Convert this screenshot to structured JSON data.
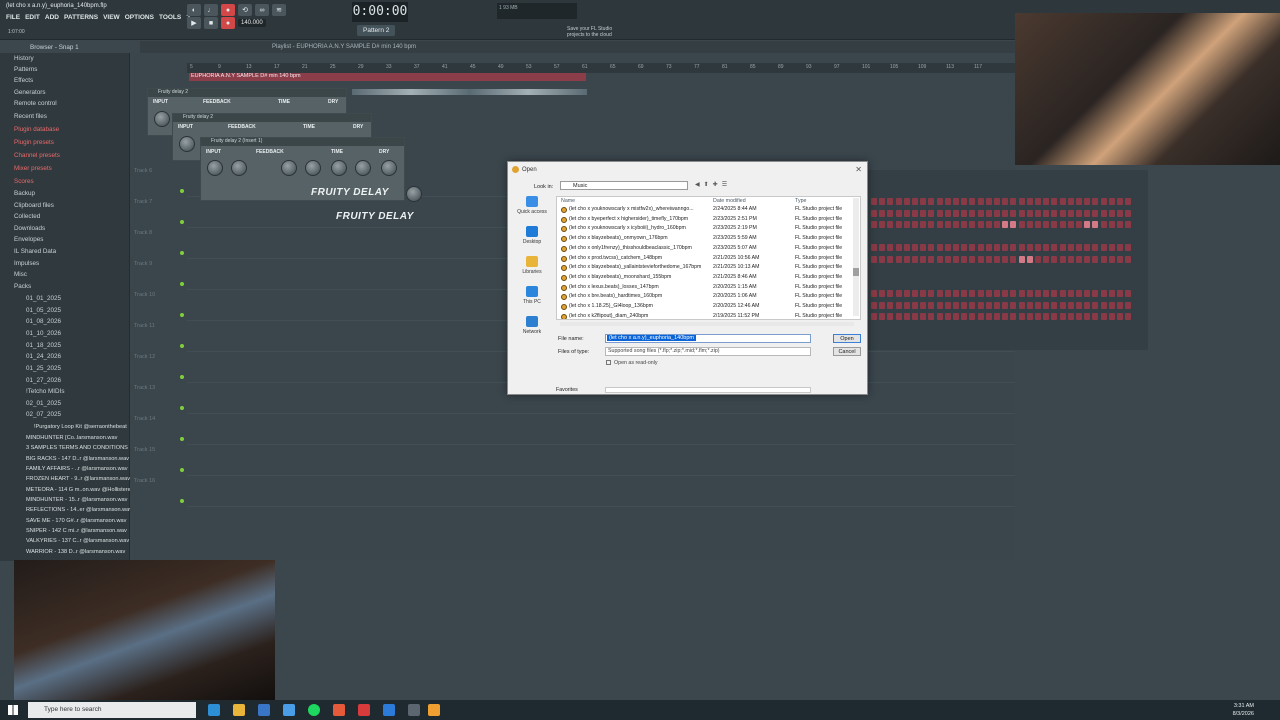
{
  "window_title": "(let cho x a.n.y)_euphoria_140bpm.flp",
  "menu": [
    "FILE",
    "EDIT",
    "ADD",
    "PATTERNS",
    "VIEW",
    "OPTIONS",
    "TOOLS",
    "?"
  ],
  "small_time": "1:07:00",
  "clock": "0:00:00",
  "tempo": "140.000",
  "pattern": "Pattern 2",
  "cloud_hint": "Save your FL Studio projects to the cloud",
  "cpu_text": "1  93 MB",
  "playlist_title": "Playlist - EUPHORIA A.N.Y SAMPLE D# min 140 bpm",
  "clip_name": "EUPHORIA A.N.Y SAMPLE D# min 140 bpm",
  "browser": {
    "items": [
      "Browser - Snap 1",
      "History",
      "Patterns",
      "Effects",
      "Generators",
      "Remote control",
      "Recent files",
      "Plugin database",
      "Plugin presets",
      "Channel presets",
      "Mixer presets",
      "Scores",
      "Backup",
      "Clipboard files",
      "Collected",
      "Downloads",
      "Envelopes",
      "IL Shared Data",
      "Impulses",
      "Misc",
      "Packs",
      "01_01_2025",
      "01_05_2025",
      "01_08_2026",
      "01_10_2026",
      "01_18_2025",
      "01_24_2026",
      "01_25_2025",
      "01_27_2026",
      "!Tetcho MIDIs",
      "02_01_2025",
      "02_07_2025"
    ],
    "files": [
      "!Purgatory Loop Kit @serraonthebeat",
      "MINDHUNTER [Co..larsmanson.wav",
      "3 SAMPLES TERMS AND CONDITIONS",
      "BIG RACKS - 147 D..r @larsmanson.wav",
      "FAMILY AFFAIRS - ..r @larsmanson.wav",
      "FROZEN HEART - 9..r @larsmanson.wav",
      "METEORA - 114 G m..on.wav @Hollistere",
      "MINDHUNTER - 15..r @larsmanson.wav",
      "REFLECTIONS - 14..er @larsmanson.wav",
      "SAVE ME - 170 G#..r @larsmanson.wav",
      "SNIPER - 142 C mi..r @larsmanson.wav",
      "VALKYRIES - 137 C..r @larsmanson.wav",
      "WARRIOR - 138 D..r @larsmanson.wav"
    ]
  },
  "ruler_ticks": [
    "5",
    "9",
    "13",
    "17",
    "21",
    "25",
    "29",
    "33",
    "37",
    "41",
    "45",
    "49",
    "53",
    "57",
    "61",
    "65",
    "69",
    "73",
    "77",
    "81",
    "85",
    "89",
    "93",
    "97",
    "101",
    "105",
    "109",
    "113",
    "117"
  ],
  "tracks": [
    "Track 6",
    "Track 7",
    "Track 8",
    "Track 9",
    "Track 10",
    "Track 11",
    "Track 12",
    "Track 13",
    "Track 14",
    "Track 15",
    "Track 16"
  ],
  "delays": [
    {
      "head": "Fruity delay 2",
      "logo": ""
    },
    {
      "head": "Fruity delay 2",
      "logo": ""
    },
    {
      "head": "Fruity delay 2 (Insert 1)",
      "logo": "FRUITY DELAY"
    },
    {
      "head": "",
      "logo": "FRUITY DELAY"
    }
  ],
  "delay_labels": [
    "INPUT",
    "FEEDBACK",
    "TIME",
    "DRY"
  ],
  "dialog": {
    "title": "Open",
    "lookin_label": "Look in:",
    "lookin_value": "Music",
    "nav": [
      "Quick access",
      "Desktop",
      "Libraries",
      "This PC",
      "Network"
    ],
    "columns": [
      "Name",
      "Date modified",
      "Type"
    ],
    "rows": [
      {
        "name": "(let cho x youknowscarly x mistfw2x)_whereiwanngo...",
        "date": "2/24/2025 8:44 AM",
        "type": "FL Studio project file"
      },
      {
        "name": "(let cho x byeperfect x highersider)_timefly_170bpm",
        "date": "2/23/2025 2:51 PM",
        "type": "FL Studio project file"
      },
      {
        "name": "(let cho x youknowscarly x icyboiii)_hydro_160bpm",
        "date": "2/23/2025 2:19 PM",
        "type": "FL Studio project file"
      },
      {
        "name": "(let cho x blayzebeats)_onmyown_176bpm",
        "date": "2/23/2025 5:59 AM",
        "type": "FL Studio project file"
      },
      {
        "name": "(let cho x only1frenzy)_thisshouldbeaclassic_170bpm",
        "date": "2/23/2025 5:07 AM",
        "type": "FL Studio project file"
      },
      {
        "name": "(let cho x prod.twcss)_catchem_148bpm",
        "date": "2/21/2025 10:56 AM",
        "type": "FL Studio project file"
      },
      {
        "name": "(let cho x blayzebeats)_yallaintstevieforthedome_167bpm",
        "date": "2/21/2025 10:13 AM",
        "type": "FL Studio project file"
      },
      {
        "name": "(let cho x blayzebeats)_moonshard_155bpm",
        "date": "2/21/2025 8:46 AM",
        "type": "FL Studio project file"
      },
      {
        "name": "(let cho x lexus.beats)_losses_147bpm",
        "date": "2/20/2025 1:15 AM",
        "type": "FL Studio project file"
      },
      {
        "name": "(let cho x bre.beats)_hardtimes_160bpm",
        "date": "2/20/2025 1:06 AM",
        "type": "FL Studio project file"
      },
      {
        "name": "(let cho x 1.18.25)_Gl4loop_136bpm",
        "date": "2/20/2025 12:46 AM",
        "type": "FL Studio project file"
      },
      {
        "name": "(let cho x k2flipout)_diam_240bpm",
        "date": "2/19/2025 11:52 PM",
        "type": "FL Studio project file"
      }
    ],
    "filename_label": "File name:",
    "filename_value": "(let cho x a.n.y)_euphoria_140bpm",
    "filetype_label": "Files of type:",
    "filetype_value": "Supported song files (*.flp;*.zip;*.mid;*.flm;*.zip)",
    "readonly_label": "Open as read-only",
    "open_label": "Open",
    "cancel_label": "Cancel",
    "favorites_label": "Favorites"
  },
  "taskbar": {
    "search_placeholder": "Type here to search",
    "time": "3:31 AM",
    "date": "8/3/2026"
  },
  "colors": {
    "accent": "#7fcf3a",
    "clip": "#8b3d4a",
    "record": "#d24848",
    "selection": "#0a64d8"
  }
}
